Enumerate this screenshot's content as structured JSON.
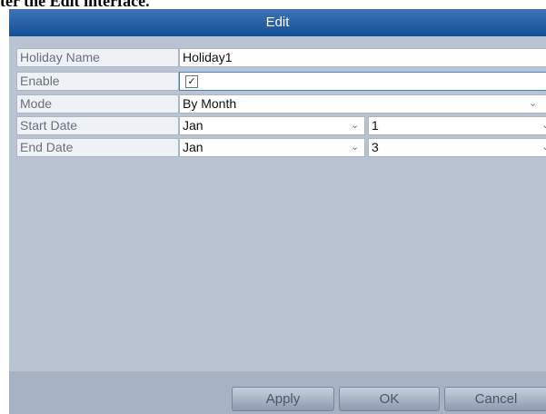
{
  "caption": "ter the Edit interface.",
  "dialog": {
    "title": "Edit",
    "fields": {
      "holiday_name": {
        "label": "Holiday Name",
        "value": "Holiday1"
      },
      "enable": {
        "label": "Enable",
        "checked": true,
        "check_glyph": "✓"
      },
      "mode": {
        "label": "Mode",
        "value": "By Month"
      },
      "start_date": {
        "label": "Start Date",
        "month": "Jan",
        "day": "1"
      },
      "end_date": {
        "label": "End Date",
        "month": "Jan",
        "day": "3"
      }
    },
    "chevron_glyph": "⌄",
    "buttons": {
      "apply": "Apply",
      "ok": "OK",
      "cancel": "Cancel"
    }
  },
  "colors": {
    "titlebar": "#144f95",
    "panel": "#b9c3d2",
    "focus_border": "#3f86c8"
  }
}
